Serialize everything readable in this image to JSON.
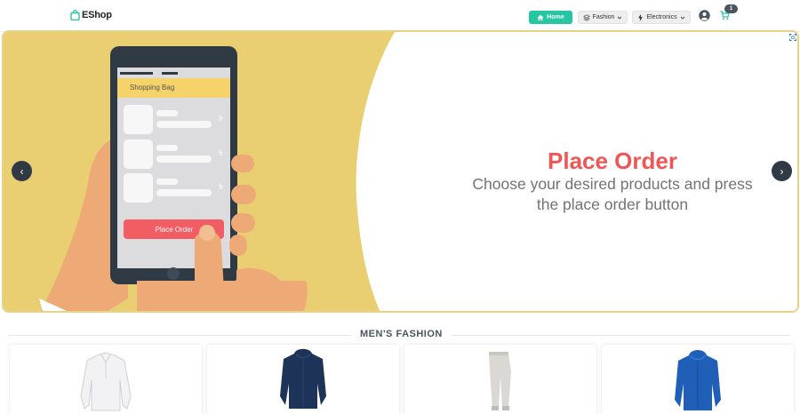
{
  "brand": {
    "name": "EShop"
  },
  "nav": {
    "home_label": "Home",
    "fashion_label": "Fashion",
    "electronics_label": "Electronics",
    "cart_count": "1"
  },
  "carousel": {
    "slide_title": "Place Order",
    "slide_description": "Choose your desired products and press the place order button",
    "phone_bag_label": "Shopping Bag",
    "phone_button_label": "Place Order",
    "prev_symbol": "‹",
    "next_symbol": "›"
  },
  "section": {
    "title": "MEN'S FASHION",
    "products": [
      {
        "icon": "white-shirt-icon",
        "color": "#f2f2f4"
      },
      {
        "icon": "navy-hoodie-icon",
        "color": "#1e3358"
      },
      {
        "icon": "grey-pants-icon",
        "color": "#d9d8d4"
      },
      {
        "icon": "blue-jacket-icon",
        "color": "#1f5fb8"
      }
    ]
  },
  "colors": {
    "accent": "#26c6a2",
    "title_red": "#ef5656",
    "banner_yellow": "#e9cf71"
  }
}
